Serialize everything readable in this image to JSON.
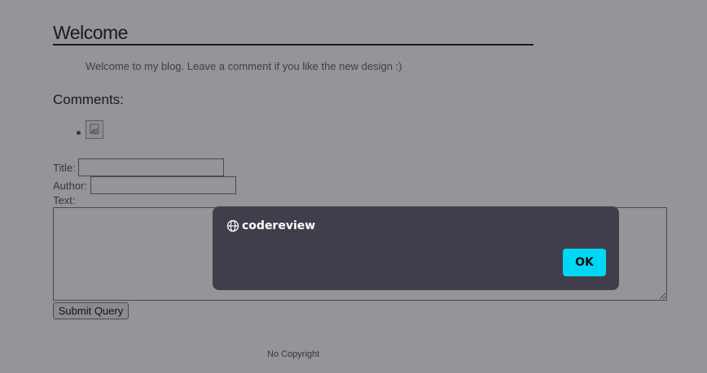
{
  "page": {
    "title": "Welcome",
    "intro": "Welcome to my blog. Leave a comment if you like the new design :)",
    "comments_heading": "Comments:",
    "form": {
      "title_label": "Title:",
      "title_value": "",
      "author_label": "Author:",
      "author_value": "",
      "text_label": "Text:",
      "text_value": "",
      "submit_label": "Submit Query"
    },
    "footer": "No Copyright"
  },
  "dialog": {
    "icon": "globe-icon",
    "title": "codereview",
    "ok_label": "OK",
    "ok_color": "#00d7f5",
    "background": "#403e4b"
  }
}
